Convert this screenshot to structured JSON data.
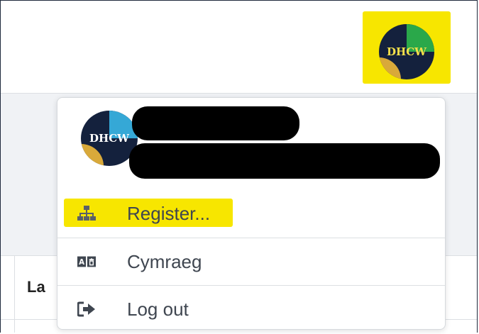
{
  "header": {
    "user_avatar_text": "DHCW",
    "highlight_color": "#f7e600"
  },
  "user_menu": {
    "avatar_text": "DHCW",
    "items": [
      {
        "label": "Register...",
        "icon": "sitemap-icon"
      },
      {
        "label": "Cymraeg",
        "icon": "language-icon"
      },
      {
        "label": "Log out",
        "icon": "sign-out-icon"
      }
    ]
  },
  "table": {
    "header_partial": "La"
  }
}
